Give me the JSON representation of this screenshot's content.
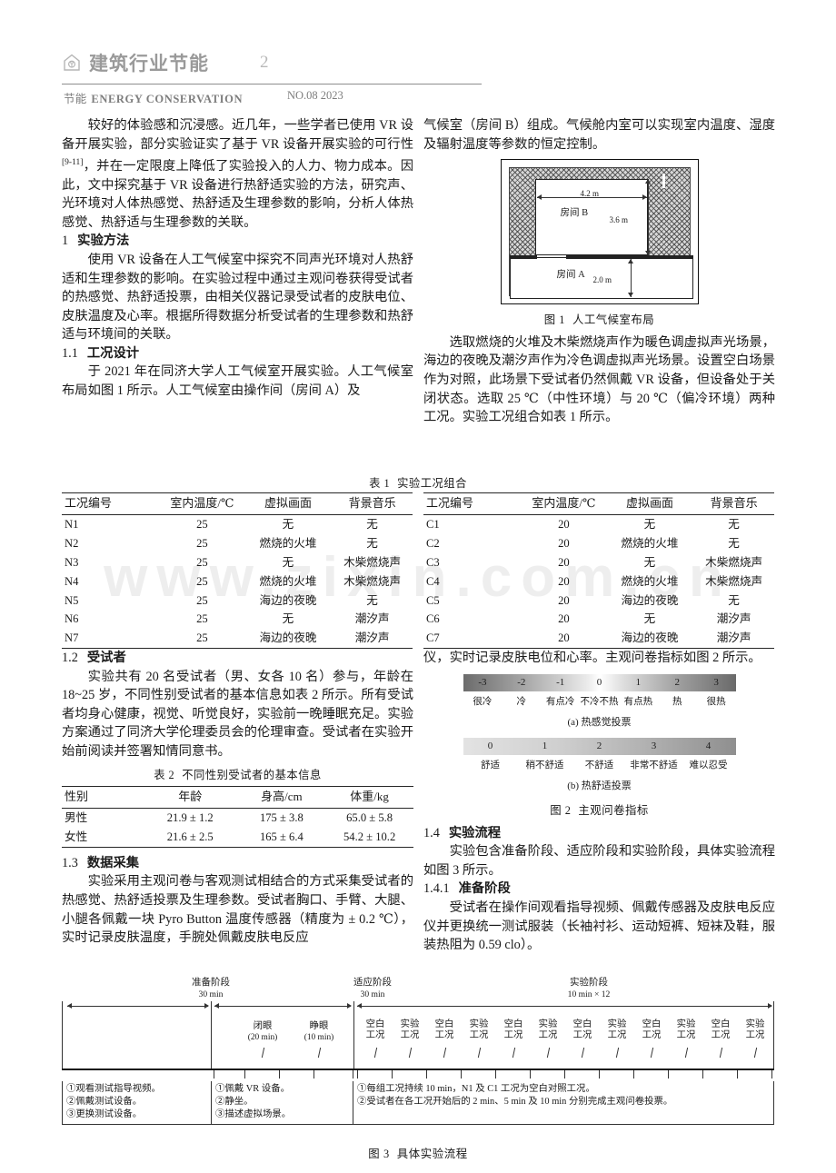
{
  "header": {
    "logo_icon": "house-leaf-icon",
    "journal_title": "建筑行业节能",
    "page_number": "2",
    "sub_cn": "节能",
    "sub_en": "ENERGY CONSERVATION",
    "issue": "NO.08 2023"
  },
  "watermark": "www.zixin.com.cn",
  "left_column": {
    "para1": "较好的体验感和沉浸感。近几年，一些学者已使用 VR 设备开展实验，部分实验证实了基于 VR 设备开展实验的可行性",
    "para1_ref": "[9-11]",
    "para1_tail": "，并在一定限度上降低了实验投入的人力、物力成本。因此，文中探究基于 VR 设备进行热舒适实验的方法，研究声、光环境对人体热感觉、热舒适及生理参数的影响，分析人体热感觉、热舒适与生理参数的关联。",
    "sec1_num": "1",
    "sec1_title": "实验方法",
    "sec1_para": "使用 VR 设备在人工气候室中探究不同声光环境对人热舒适和生理参数的影响。在实验过程中通过主观问卷获得受试者的热感觉、热舒适投票，由相关仪器记录受试者的皮肤电位、皮肤温度及心率。根据所得数据分析受试者的生理参数和热舒适与环境间的关联。",
    "sec11_num": "1.1",
    "sec11_title": "工况设计",
    "sec11_para": "于 2021 年在同济大学人工气候室开展实验。人工气候室布局如图 1 所示。人工气候室由操作间（房间 A）及",
    "sec12_num": "1.2",
    "sec12_title": "受试者",
    "sec12_para": "实验共有 20 名受试者（男、女各 10 名）参与，年龄在 18~25 岁，不同性别受试者的基本信息如表 2 所示。所有受试者均身心健康，视觉、听觉良好，实验前一晚睡眠充足。实验方案通过了同济大学伦理委员会的伦理审查。受试者在实验开始前阅读并签署知情同意书。",
    "sec13_num": "1.3",
    "sec13_title": "数据采集",
    "sec13_para": "实验采用主观问卷与客观测试相结合的方式采集受试者的热感觉、热舒适投票及生理参数。受试者胸口、手臂、大腿、小腿各佩戴一块 Pyro Button 温度传感器（精度为 ± 0.2 ℃），实时记录皮肤温度，手腕处佩戴皮肤电反应"
  },
  "right_column": {
    "para_top": "气候室（房间 B）组成。气候舱内室可以实现室内温度、湿度及辐射温度等参数的恒定控制。",
    "para_after_fig1": "选取燃烧的火堆及木柴燃烧声作为暖色调虚拟声光场景，海边的夜晚及潮汐声作为冷色调虚拟声光场景。设置空白场景作为对照，此场景下受试者仍然佩戴 VR 设备，但设备处于关闭状态。选取 25 ℃（中性环境）与 20 ℃（偏冷环境）两种工况。实验工况组合如表 1 所示。",
    "para_after_table1": "仪，实时记录皮肤电位和心率。主观问卷指标如图 2 所示。",
    "sec14_num": "1.4",
    "sec14_title": "实验流程",
    "sec14_para": "实验包含准备阶段、适应阶段和实验阶段，具体实验流程如图 3 所示。",
    "sec141_num": "1.4.1",
    "sec141_title": "准备阶段",
    "sec141_para": "受试者在操作间观看指导视频、佩戴传感器及皮肤电反应仪并更换统一测试服装（长袖衬衫、运动短裤、短袜及鞋，服装热阻为 0.59 clo）。"
  },
  "figure1": {
    "caption_num": "图 1",
    "caption_text": "人工气候室布局",
    "room_b_label": "房间 B",
    "room_a_label": "房间 A",
    "dim_width": "4.2 m",
    "dim_height_b": "3.6 m",
    "dim_height_a": "2.0 m"
  },
  "table1": {
    "caption_num": "表 1",
    "caption_text": "实验工况组合",
    "headers": [
      "工况编号",
      "室内温度/℃",
      "虚拟画面",
      "背景音乐"
    ],
    "rows_left": [
      [
        "N1",
        "25",
        "无",
        "无"
      ],
      [
        "N2",
        "25",
        "燃烧的火堆",
        "无"
      ],
      [
        "N3",
        "25",
        "无",
        "木柴燃烧声"
      ],
      [
        "N4",
        "25",
        "燃烧的火堆",
        "木柴燃烧声"
      ],
      [
        "N5",
        "25",
        "海边的夜晚",
        "无"
      ],
      [
        "N6",
        "25",
        "无",
        "潮汐声"
      ],
      [
        "N7",
        "25",
        "海边的夜晚",
        "潮汐声"
      ]
    ],
    "rows_right": [
      [
        "C1",
        "20",
        "无",
        "无"
      ],
      [
        "C2",
        "20",
        "燃烧的火堆",
        "无"
      ],
      [
        "C3",
        "20",
        "无",
        "木柴燃烧声"
      ],
      [
        "C4",
        "20",
        "燃烧的火堆",
        "木柴燃烧声"
      ],
      [
        "C5",
        "20",
        "海边的夜晚",
        "无"
      ],
      [
        "C6",
        "20",
        "无",
        "潮汐声"
      ],
      [
        "C7",
        "20",
        "海边的夜晚",
        "潮汐声"
      ]
    ]
  },
  "table2": {
    "caption_num": "表 2",
    "caption_text": "不同性别受试者的基本信息",
    "headers": [
      "性别",
      "年龄",
      "身高/cm",
      "体重/kg"
    ],
    "rows": [
      [
        "男性",
        "21.9 ± 1.2",
        "175 ± 3.8",
        "65.0 ± 5.8"
      ],
      [
        "女性",
        "21.6 ± 2.5",
        "165 ± 6.4",
        "54.2 ± 10.2"
      ]
    ]
  },
  "figure2": {
    "caption_num": "图 2",
    "caption_text": "主观问卷指标",
    "tsv": {
      "values": [
        "-3",
        "-2",
        "-1",
        "0",
        "1",
        "2",
        "3"
      ],
      "labels": [
        "很冷",
        "冷",
        "有点冷",
        "不冷不热",
        "有点热",
        "热",
        "很热"
      ],
      "subcaption": "(a) 热感觉投票"
    },
    "tcv": {
      "values": [
        "0",
        "1",
        "2",
        "3",
        "4"
      ],
      "labels": [
        "舒适",
        "稍不舒适",
        "不舒适",
        "非常不舒适",
        "难以忍受"
      ],
      "subcaption": "(b) 热舒适投票"
    }
  },
  "figure3": {
    "caption_num": "图 3",
    "caption_text": "具体实验流程",
    "phases": [
      {
        "title": "准备阶段",
        "duration": "30 min"
      },
      {
        "title": "适应阶段",
        "duration": "30 min"
      },
      {
        "title": "实验阶段",
        "duration": "10 min × 12"
      }
    ],
    "adapt_sub": [
      {
        "title": "闭眼",
        "duration": "(20 min)"
      },
      {
        "title": "睁眼",
        "duration": "(10 min)"
      }
    ],
    "trial_labels": [
      "空白\n工况",
      "实验\n工况",
      "空白\n工况",
      "实验\n工况",
      "空白\n工况",
      "实验\n工况",
      "空白\n工况",
      "实验\n工况",
      "空白\n工况",
      "实验\n工况",
      "空白\n工况",
      "实验\n工况"
    ],
    "notes": [
      "①观看测试指导视频。\n②佩戴测试设备。\n③更换测试设备。",
      "①佩戴 VR 设备。\n②静坐。\n③描述虚拟场景。",
      "①每组工况持续 10 min，N1 及 C1 工况为空白对照工况。\n②受试者在各工况开始后的 2 min、5 min 及 10 min 分别完成主观问卷投票。"
    ]
  }
}
